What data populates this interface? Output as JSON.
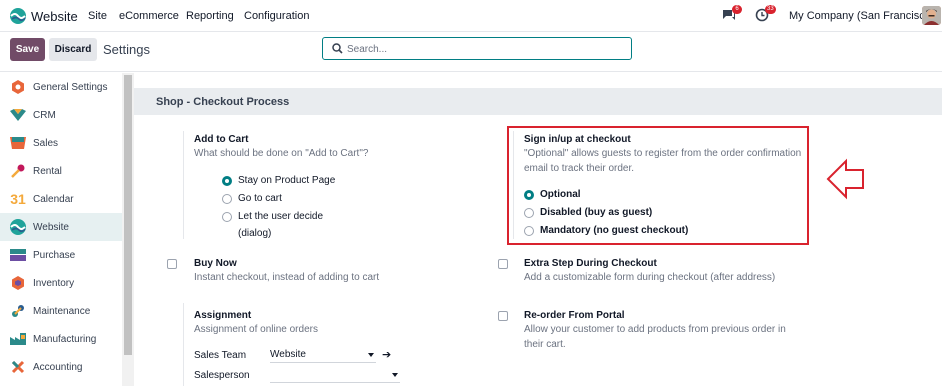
{
  "navbar": {
    "app_name": "Website",
    "menu": [
      "Site",
      "eCommerce",
      "Reporting",
      "Configuration"
    ],
    "messages_count": "6",
    "activities_count": "33",
    "company": "My Company (San Francisco)"
  },
  "control_panel": {
    "save_label": "Save",
    "discard_label": "Discard",
    "title": "Settings",
    "search_placeholder": "Search..."
  },
  "sidebar": {
    "items": [
      {
        "label": "General Settings",
        "icon": "gear-icon"
      },
      {
        "label": "CRM",
        "icon": "crm-icon"
      },
      {
        "label": "Sales",
        "icon": "sales-icon"
      },
      {
        "label": "Rental",
        "icon": "rental-icon"
      },
      {
        "label": "Calendar",
        "icon": "calendar-icon"
      },
      {
        "label": "Website",
        "icon": "website-icon",
        "active": true
      },
      {
        "label": "Purchase",
        "icon": "purchase-icon"
      },
      {
        "label": "Inventory",
        "icon": "inventory-icon"
      },
      {
        "label": "Maintenance",
        "icon": "maintenance-icon"
      },
      {
        "label": "Manufacturing",
        "icon": "manufacturing-icon"
      },
      {
        "label": "Accounting",
        "icon": "accounting-icon"
      }
    ],
    "calendar_day": "31"
  },
  "section": {
    "title": "Shop - Checkout Process"
  },
  "add_to_cart": {
    "title": "Add to Cart",
    "description": "What should be done on \"Add to Cart\"?",
    "options": [
      {
        "label": "Stay on Product Page",
        "selected": true
      },
      {
        "label": "Go to cart",
        "selected": false
      },
      {
        "label": "Let the user decide",
        "label2": "(dialog)",
        "selected": false
      }
    ]
  },
  "signin": {
    "title": "Sign in/up at checkout",
    "description_line1": "\"Optional\" allows guests to register from the order confirmation",
    "description_line2": "email to track their order.",
    "options": [
      {
        "label": "Optional",
        "selected": true
      },
      {
        "label": "Disabled (buy as guest)",
        "selected": false
      },
      {
        "label": "Mandatory (no guest checkout)",
        "selected": false
      }
    ]
  },
  "buy_now": {
    "title": "Buy Now",
    "description": "Instant checkout, instead of adding to cart",
    "checked": false
  },
  "extra_step": {
    "title": "Extra Step During Checkout",
    "description": "Add a customizable form during checkout (after address)",
    "checked": false
  },
  "assignment": {
    "title": "Assignment",
    "description": "Assignment of online orders",
    "sales_team_label": "Sales Team",
    "sales_team_value": "Website",
    "salesperson_label": "Salesperson",
    "salesperson_value": ""
  },
  "reorder": {
    "title": "Re-order From Portal",
    "description_line1": "Allow your customer to add products from previous order in",
    "description_line2": "their cart.",
    "checked": false
  },
  "colors": {
    "primary": "#714b67",
    "accent": "#017e84",
    "highlight": "#d9232e"
  }
}
